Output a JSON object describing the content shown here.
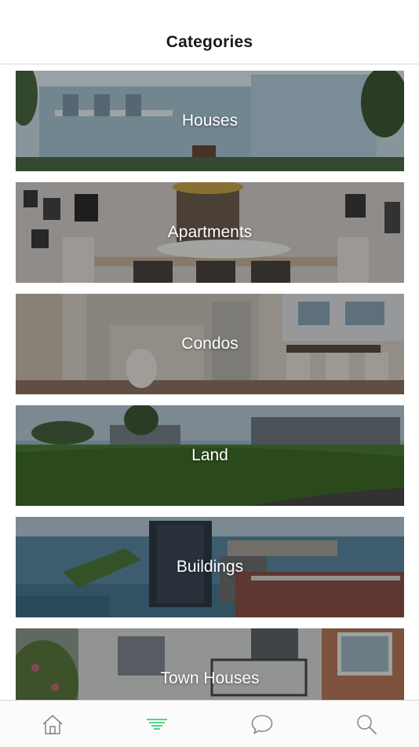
{
  "header": {
    "title": "Categories"
  },
  "categories": [
    {
      "label": "Houses",
      "image": "house-photo"
    },
    {
      "label": "Apartments",
      "image": "dining-room-photo"
    },
    {
      "label": "Condos",
      "image": "kitchen-photo"
    },
    {
      "label": "Land",
      "image": "lawn-photo"
    },
    {
      "label": "Buildings",
      "image": "waterfront-city-photo"
    },
    {
      "label": "Town Houses",
      "image": "townhouse-photo"
    }
  ],
  "tabbar": {
    "active_color": "#3ecf7a",
    "inactive_color": "#8a8a8a",
    "tabs": [
      {
        "icon": "home-icon",
        "active": false
      },
      {
        "icon": "list-icon",
        "active": true
      },
      {
        "icon": "chat-icon",
        "active": false
      },
      {
        "icon": "search-icon",
        "active": false
      }
    ]
  }
}
